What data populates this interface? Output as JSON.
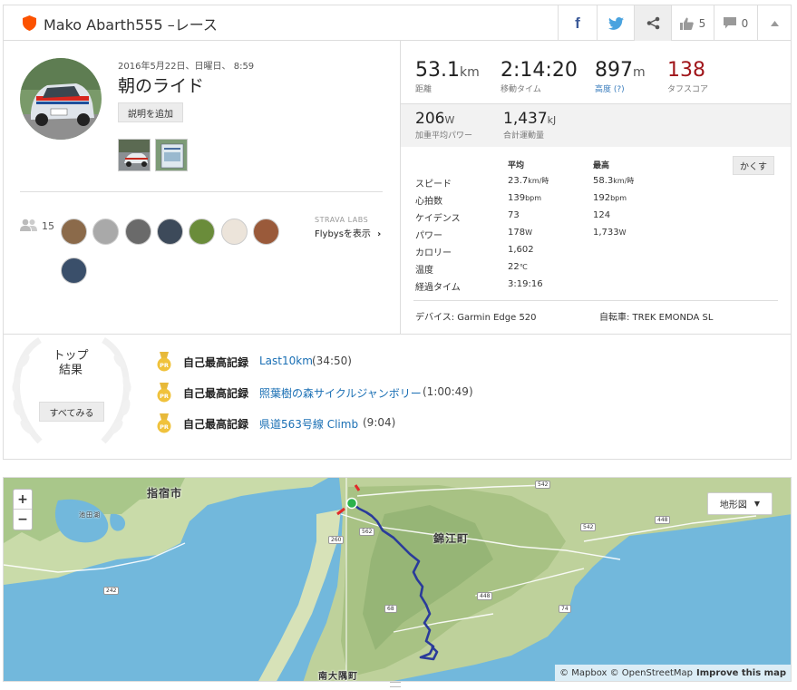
{
  "header": {
    "title": "Mako Abarth555 –レース",
    "kudos_count": "5",
    "comment_count": "0"
  },
  "activity": {
    "date": "2016年5月22日、日曜日、 8:59",
    "name": "朝のライド",
    "add_description": "説明を追加",
    "kudos_total": "15",
    "labs_small": "STRAVA LABS",
    "labs_link": "Flybysを表示"
  },
  "stats": {
    "distance": {
      "value": "53.1",
      "unit": "km",
      "label": "距離"
    },
    "moving_time": {
      "value": "2:14:20",
      "label": "移動タイム"
    },
    "elevation": {
      "value": "897",
      "unit": "m",
      "label": "高度 (?)"
    },
    "suffer": {
      "value": "138",
      "label": "タフスコア"
    },
    "power": {
      "value": "206",
      "unit": "W",
      "label": "加重平均パワー"
    },
    "energy": {
      "value": "1,437",
      "unit": "kJ",
      "label": "合計運動量"
    }
  },
  "table": {
    "hide_button": "かくす",
    "col_avg": "平均",
    "col_max": "最高",
    "rows": [
      {
        "label": "スピード",
        "avg": "23.7",
        "avg_unit": "km/時",
        "max": "58.3",
        "max_unit": "km/時"
      },
      {
        "label": "心拍数",
        "avg": "139",
        "avg_unit": "bpm",
        "max": "192",
        "max_unit": "bpm"
      },
      {
        "label": "ケイデンス",
        "avg": "73",
        "avg_unit": "",
        "max": "124",
        "max_unit": ""
      },
      {
        "label": "パワー",
        "avg": "178",
        "avg_unit": "W",
        "max": "1,733",
        "max_unit": "W"
      },
      {
        "label": "カロリー",
        "avg": "1,602",
        "avg_unit": "",
        "max": "",
        "max_unit": ""
      },
      {
        "label": "温度",
        "avg": "22",
        "avg_unit": "℃",
        "max": "",
        "max_unit": ""
      },
      {
        "label": "経過タイム",
        "avg": "3:19:16",
        "avg_unit": "",
        "max": "",
        "max_unit": ""
      }
    ],
    "device": "デバイス: Garmin Edge 520",
    "bike": "自転車: TREK EMONDA SL"
  },
  "top_results": {
    "title_line1": "トップ",
    "title_line2": "結果",
    "see_all": "すべてみる",
    "items": [
      {
        "label": "自己最高記録",
        "segment": "Last10km",
        "time": "(34:50)"
      },
      {
        "label": "自己最高記録",
        "segment": "照葉樹の森サイクルジャンボリー",
        "time": "(1:00:49)"
      },
      {
        "label": "自己最高記録",
        "segment": "県道563号線 Climb",
        "time": "(9:04)"
      }
    ],
    "medal_text": "PR"
  },
  "map": {
    "zoom_in": "+",
    "zoom_out": "−",
    "map_type": "地形図",
    "attribution": "© Mapbox © OpenStreetMap",
    "improve": "Improve this map",
    "labels": {
      "ibusuki": "指宿市",
      "nishiki": "錦江町",
      "minamiosumi": "南大隅町",
      "ikeda": "池田湖"
    },
    "roads": [
      "542",
      "542",
      "448",
      "260",
      "562",
      "242",
      "448",
      "68",
      "74"
    ]
  },
  "colors": {
    "strava_orange": "#fc5200",
    "link": "#1a6fb4",
    "suffer_red": "#a0161b",
    "route": "#2a3b9a"
  }
}
